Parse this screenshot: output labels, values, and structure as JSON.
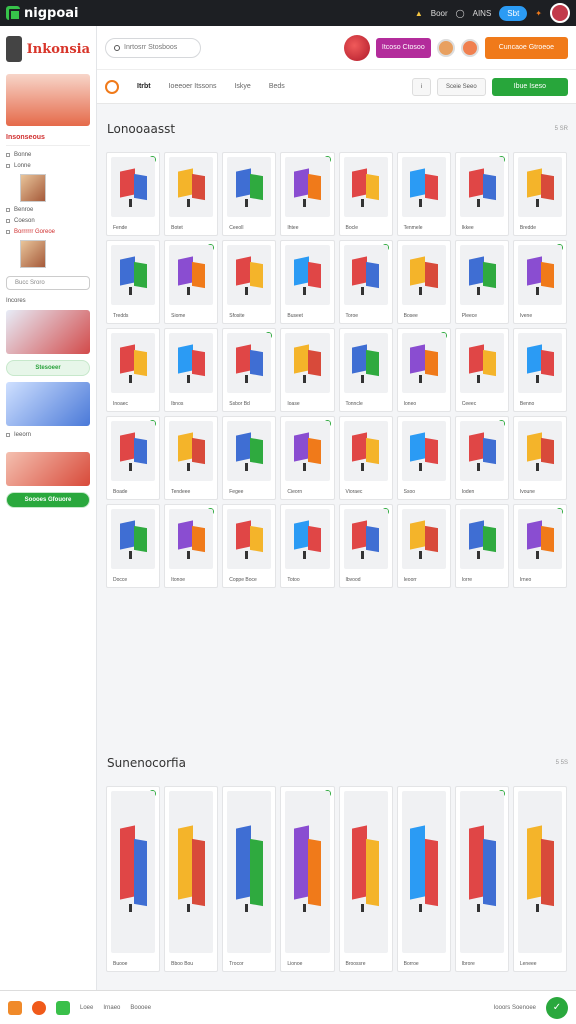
{
  "topbar": {
    "app_name": "nigpoai",
    "item1": "Boor",
    "item2": "AINS",
    "pill": "Sbt"
  },
  "sidebar": {
    "brand": "Inkonsia",
    "section_title": "Insonseous",
    "rows": [
      "Bonne",
      "Lonne",
      "Benroe",
      "Coeson",
      "Borrrrrr Goreoe"
    ],
    "input_placeholder": "Bucc Sroro",
    "group_label": "Incores",
    "pill1": "Stesoeer",
    "row_label2": "Ieeorn",
    "pill2": "Soooes Gfouore"
  },
  "header": {
    "search_placeholder": "Inrtosrr Stosboos",
    "pink_button": "Itcoso Ctosoo",
    "orange_button": "Cuncaoe Gtroeoe"
  },
  "tabs": {
    "items": [
      "Itrbt",
      "Ioeeoer Itssons",
      "Iskye",
      "Beds"
    ],
    "filter_btn": "Sceie Seeo",
    "green_btn": "Ibue Iseso"
  },
  "sections": [
    {
      "title": "Lonooaasst",
      "count": "5 SR"
    },
    {
      "title": "Sunenocorfia",
      "count": "5 5S"
    }
  ],
  "grid1": [
    "Fende",
    "Botet",
    "Ceeoll",
    "Ihtee",
    "Bocle",
    "Tenmele",
    "Ikkee",
    "Bredde",
    "Tredds",
    "Siome",
    "Sfosite",
    "Buseet",
    "Toroe",
    "Bosee",
    "Pleece",
    "Ivene",
    "Inoaec",
    "Ibnos",
    "Ssbor Bd",
    "Ioase",
    "Tonncle",
    "Ioneo",
    "Ceeec",
    "Benno",
    "Boade",
    "Tendeee",
    "Fegee",
    "Cieorn",
    "Vioraec",
    "Ssoo",
    "Ioden",
    "Ivoune",
    "Docce",
    "Itonoe",
    "Coppe Boce",
    "Totoo",
    "Ibvood",
    "Ieoorr",
    "Iorre",
    "Irneo"
  ],
  "grid2": [
    "Buooe",
    "Bboo Bou",
    "Trocor",
    "Lionoe",
    "Broossre",
    "Borroe",
    "Ibrore",
    "Leneee"
  ],
  "bottom": {
    "items": [
      "Loee",
      "Irnaeo",
      "Boooee"
    ],
    "right": "Iooors Soenoee"
  }
}
